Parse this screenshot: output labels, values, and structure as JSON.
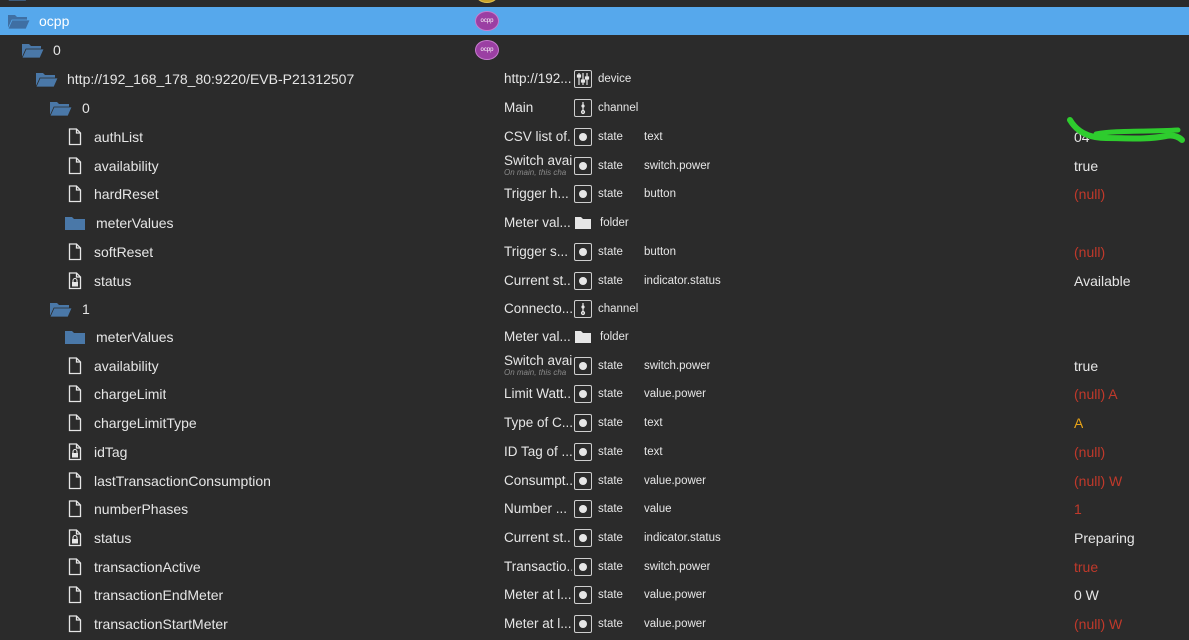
{
  "colors": {
    "selected": "#56a8ec",
    "null_value": "#c0392b",
    "warn_value": "#e8a317",
    "folder_blue": "#4a78a8",
    "marker_green": "#2ecc2e"
  },
  "top_row": {
    "logo_text": ""
  },
  "adapter": {
    "name": "ocpp",
    "logo_text": "ocpp"
  },
  "instance": {
    "name": "0",
    "logo_text": "ocpp"
  },
  "device": {
    "name": "http://192_168_178_80:9220/EVB-P21312507",
    "desc": "http://192...",
    "type": "device"
  },
  "channel0": {
    "name": "0",
    "desc": "Main",
    "type": "channel"
  },
  "channel1": {
    "name": "1",
    "desc": "Connecto...",
    "type": "channel"
  },
  "rows0": [
    {
      "name": "authList",
      "desc": "CSV list of...",
      "type": "state",
      "role": "text",
      "value": "04",
      "cls": "normal"
    },
    {
      "name": "availability",
      "desc": "Switch availa",
      "sub": "On main, this cha",
      "type": "state",
      "role": "switch.power",
      "value": "true",
      "cls": "normal"
    },
    {
      "name": "hardReset",
      "desc": "Trigger h...",
      "type": "state",
      "role": "button",
      "value": "(null)",
      "cls": "null"
    },
    {
      "name": "meterValues",
      "desc": "Meter val...",
      "type": "folder",
      "role": "",
      "value": "",
      "cls": "normal"
    },
    {
      "name": "softReset",
      "desc": "Trigger s...",
      "type": "state",
      "role": "button",
      "value": "(null)",
      "cls": "null"
    },
    {
      "name": "status",
      "desc": "Current st...",
      "type": "state",
      "role": "indicator.status",
      "value": "Available",
      "cls": "normal"
    }
  ],
  "rows1": [
    {
      "name": "meterValues",
      "desc": "Meter val...",
      "type": "folder",
      "role": "",
      "value": "",
      "cls": "normal"
    },
    {
      "name": "availability",
      "desc": "Switch availa",
      "sub": "On main, this cha",
      "type": "state",
      "role": "switch.power",
      "value": "true",
      "cls": "normal"
    },
    {
      "name": "chargeLimit",
      "desc": "Limit Watt...",
      "type": "state",
      "role": "value.power",
      "value": "(null) A",
      "cls": "null"
    },
    {
      "name": "chargeLimitType",
      "desc": "Type of C...",
      "type": "state",
      "role": "text",
      "value": "A",
      "cls": "warn"
    },
    {
      "name": "idTag",
      "desc": "ID Tag of ...",
      "type": "state",
      "role": "text",
      "value": "(null)",
      "cls": "null"
    },
    {
      "name": "lastTransactionConsumption",
      "desc": "Consumpt...",
      "type": "state",
      "role": "value.power",
      "value": "(null) W",
      "cls": "null"
    },
    {
      "name": "numberPhases",
      "desc": "Number ...",
      "type": "state",
      "role": "value",
      "value": "1",
      "cls": "null"
    },
    {
      "name": "status",
      "desc": "Current st...",
      "type": "state",
      "role": "indicator.status",
      "value": "Preparing",
      "cls": "normal"
    },
    {
      "name": "transactionActive",
      "desc": "Transactio...",
      "type": "state",
      "role": "switch.power",
      "value": "true",
      "cls": "null"
    },
    {
      "name": "transactionEndMeter",
      "desc": "Meter at l...",
      "type": "state",
      "role": "value.power",
      "value": "0 W",
      "cls": "normal"
    },
    {
      "name": "transactionStartMeter",
      "desc": "Meter at l...",
      "type": "state",
      "role": "value.power",
      "value": "(null) W",
      "cls": "null"
    }
  ]
}
